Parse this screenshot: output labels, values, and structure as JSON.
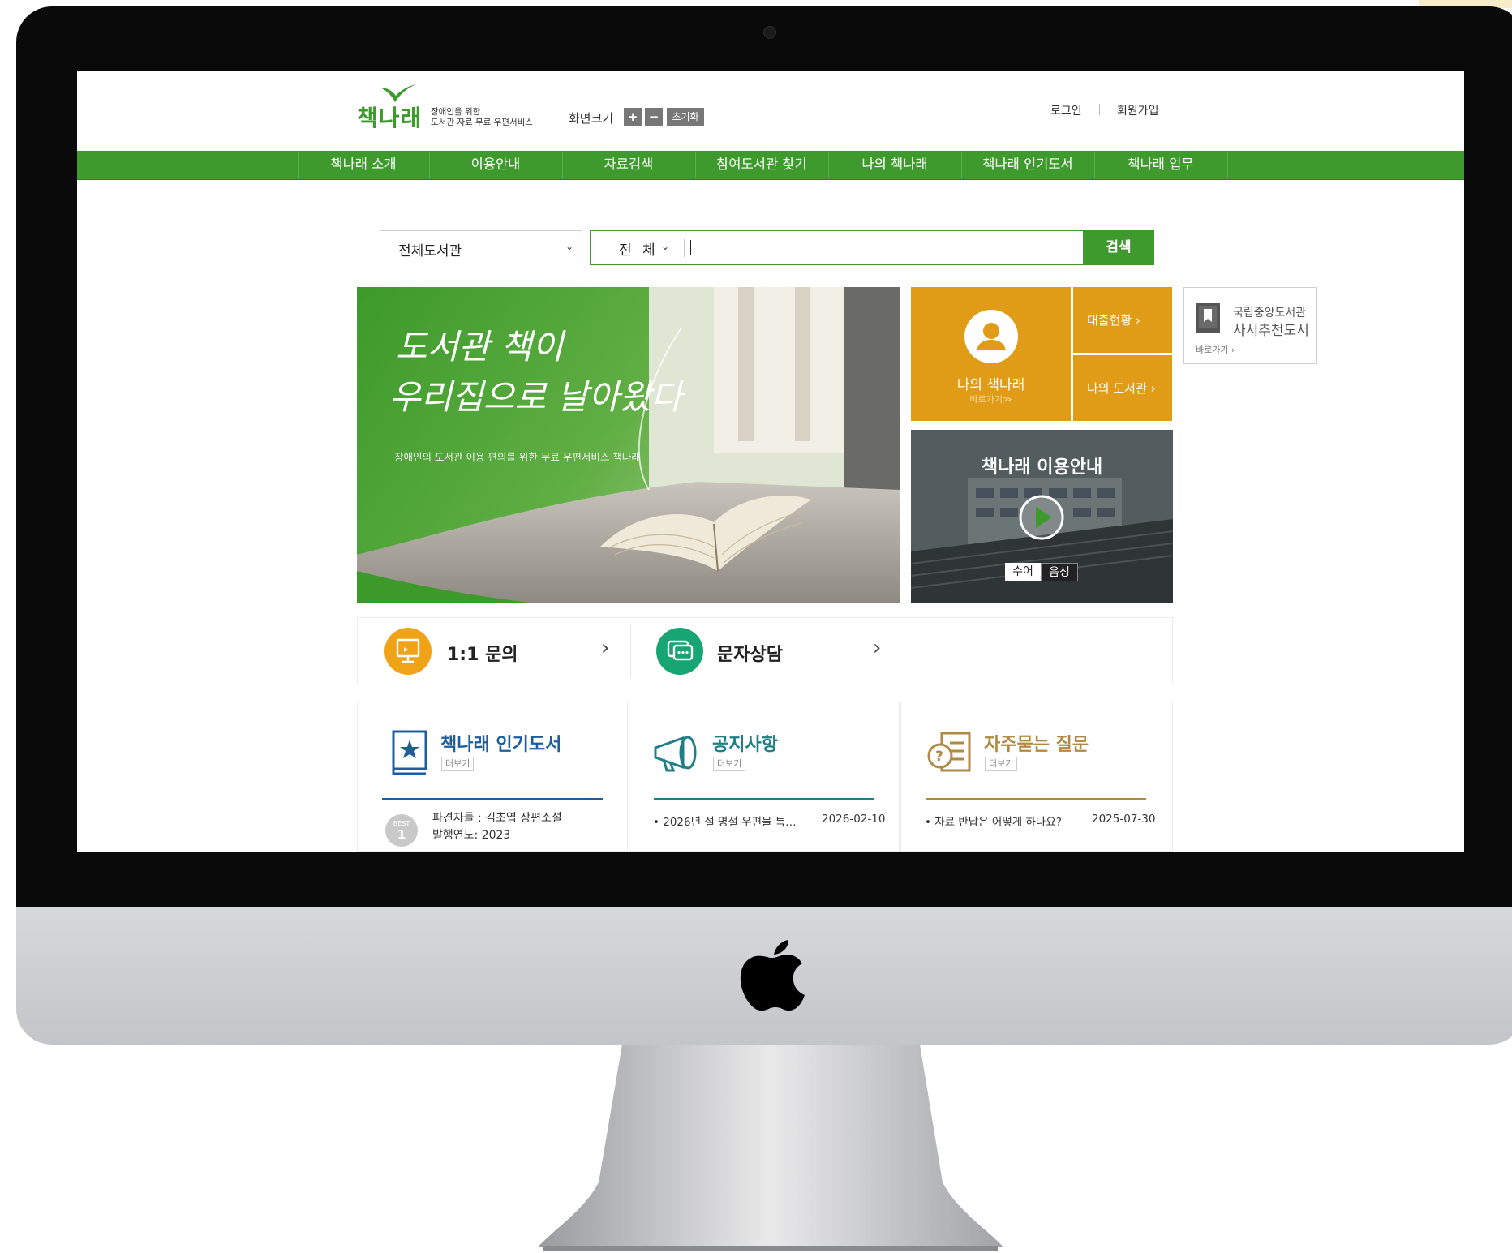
{
  "header": {
    "logo_text": "책나래",
    "logo_tagline_1": "장애인을 위한",
    "logo_tagline_2": "도서관 자료 무료 우편서비스",
    "zoom_label": "화면크기",
    "zoom_in": "+",
    "zoom_out": "−",
    "zoom_reset": "초기화",
    "login": "로그인",
    "signup": "회원가입"
  },
  "nav": {
    "items": [
      "책나래 소개",
      "이용안내",
      "자료검색",
      "참여도서관 찾기",
      "나의 책나래",
      "책나래 인기도서",
      "책나래 업무"
    ]
  },
  "search": {
    "library_select": "전체도서관",
    "scope_select": "전 체",
    "query": "",
    "button": "검색"
  },
  "banner": {
    "headline_line1": "도서관 책이",
    "headline_line2": "우리집으로 날아왔다",
    "subtitle": "장애인의 도서관 이용 편의를 위한 무료 우편서비스 책나래"
  },
  "my_booknarae": {
    "title": "나의 책나래",
    "go": "바로가기≫",
    "loan_status": "대출현황 ›",
    "my_library": "나의 도서관 ›"
  },
  "nlk": {
    "line1": "국립중앙도서관",
    "line2": "사서추천도서",
    "go": "바로가기 ›"
  },
  "video": {
    "title": "책나래 이용안내",
    "sign_language": "수어",
    "voice": "음성"
  },
  "quick_links": {
    "inquiry": "1:1 문의",
    "text_chat": "문자상담",
    "arrow": "›"
  },
  "panels": {
    "popular": {
      "title": "책나래 인기도서",
      "more": "더보기",
      "badge_top": "BEST",
      "badge_num": "1",
      "item_title": "파견자들 : 김초엽 장편소설",
      "item_year": "발행연도: 2023"
    },
    "notice": {
      "title": "공지사항",
      "more": "더보기",
      "item": "• 2026년 설 명절 우편물 특…",
      "date": "2026-02-10"
    },
    "faq": {
      "title": "자주묻는 질문",
      "more": "더보기",
      "item": "• 자료 반납은 어떻게 하나요?",
      "date": "2025-07-30"
    }
  },
  "colors": {
    "brand_green": "#3f9a2e",
    "orange": "#e09c16",
    "popular_blue": "#1e5e9e",
    "notice_teal": "#1f7f86",
    "faq_gold": "#b08a45"
  }
}
